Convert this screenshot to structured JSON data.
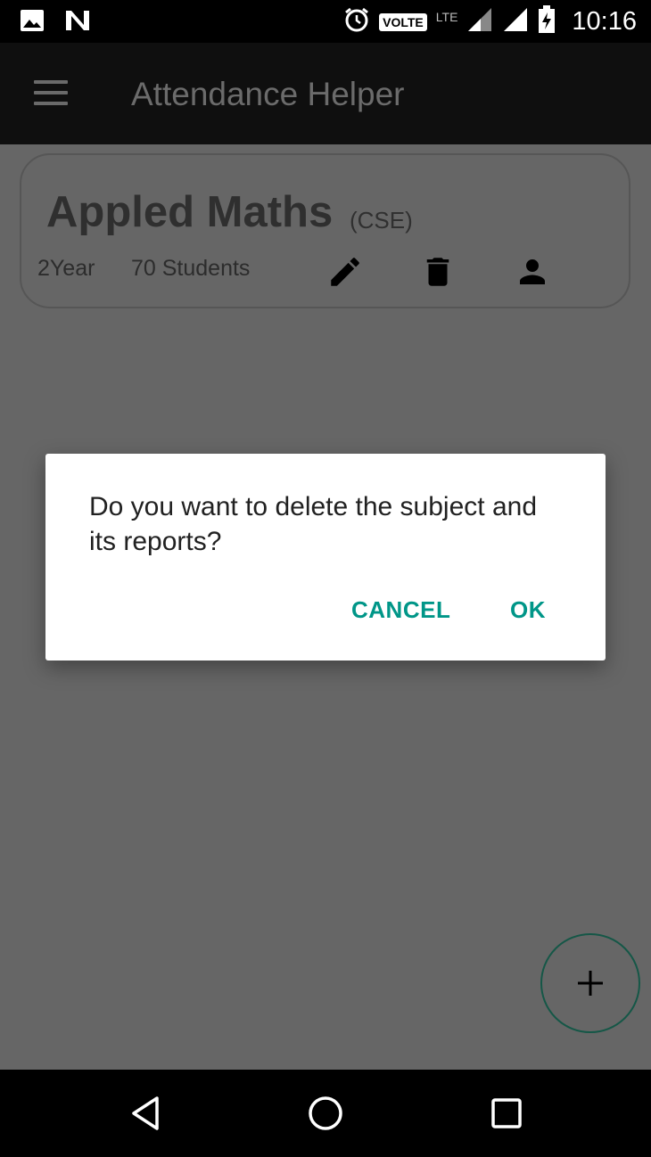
{
  "status_bar": {
    "time": "10:16",
    "volte": "VOLTE",
    "lte": "LTE",
    "icons": [
      "image-icon",
      "n-notification-icon",
      "alarm-icon",
      "signal-icon",
      "signal-icon",
      "battery-charging-icon"
    ]
  },
  "app_bar": {
    "title": "Attendance Helper",
    "menu_icon": "menu-icon"
  },
  "subject": {
    "name": "Appled Maths",
    "department": "(CSE)",
    "year": "2Year",
    "students": "70 Students",
    "actions": [
      "edit-icon",
      "delete-icon",
      "person-icon"
    ]
  },
  "dialog": {
    "message": "Do you want to delete the subject and its reports?",
    "cancel_label": "CANCEL",
    "ok_label": "OK",
    "accent_color": "#009688"
  },
  "fab": {
    "icon": "plus-icon"
  },
  "nav_bar": {
    "icons": [
      "back-icon",
      "home-icon",
      "recents-icon"
    ]
  }
}
